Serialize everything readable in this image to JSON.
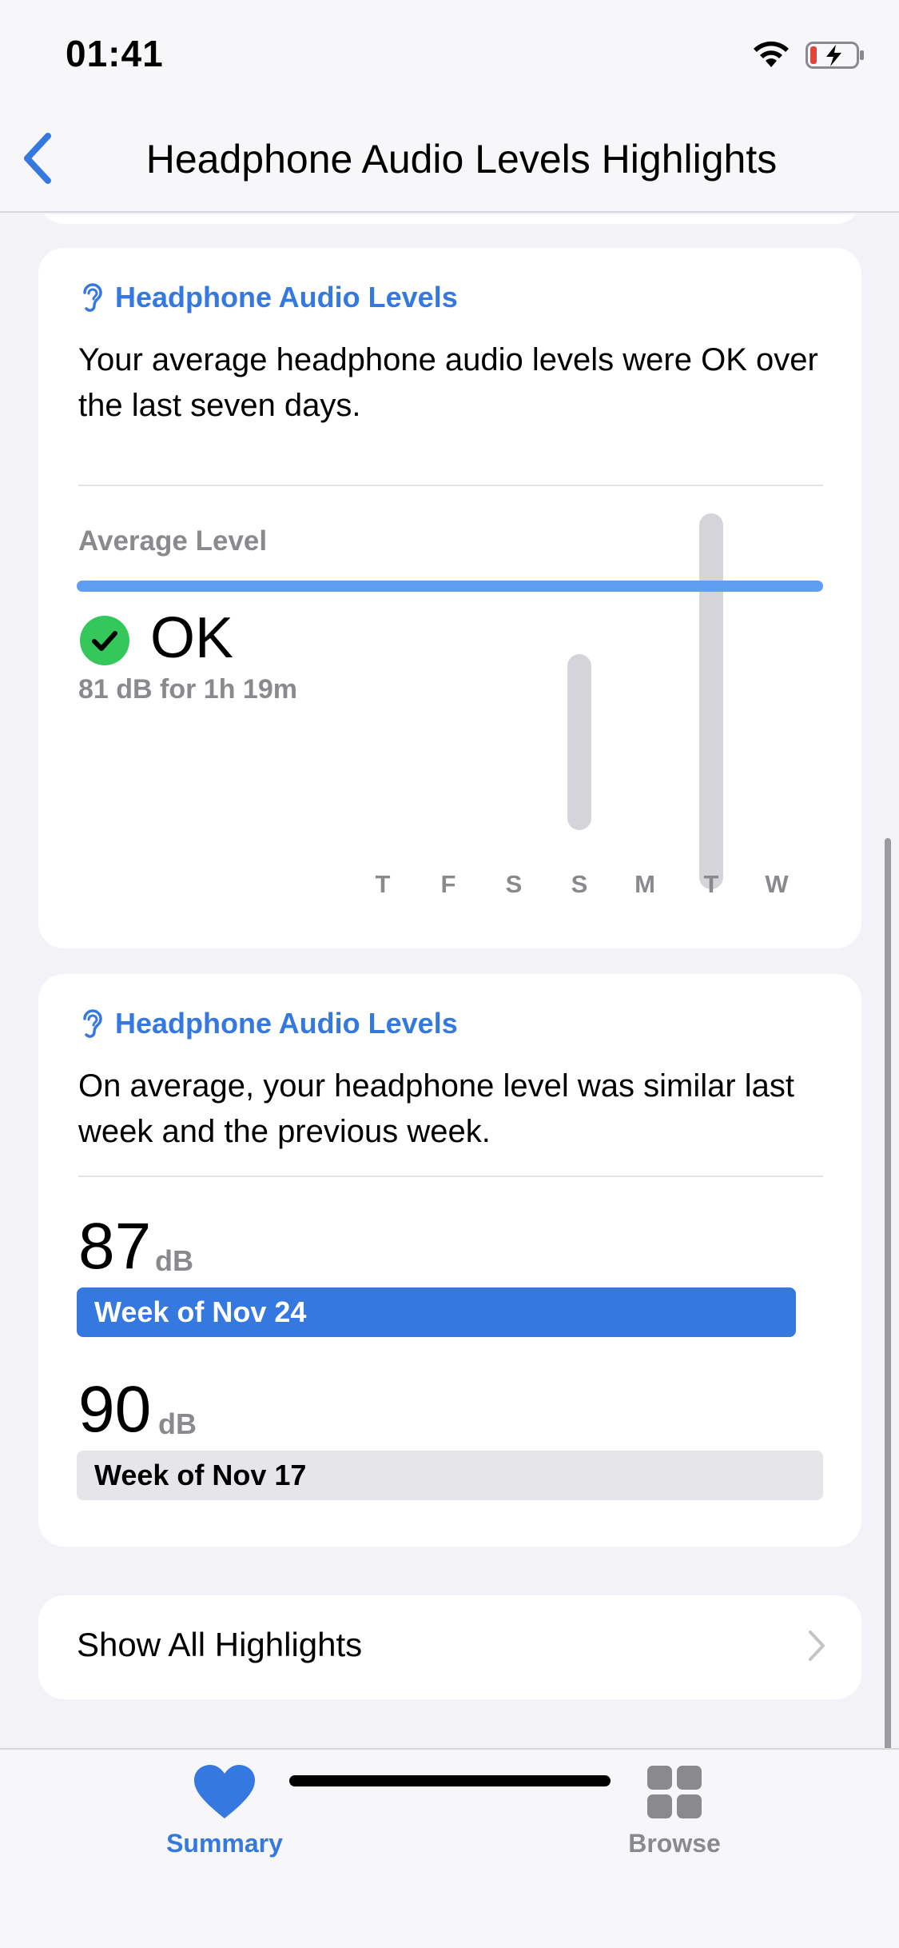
{
  "status_bar": {
    "time": "01:41"
  },
  "nav": {
    "title": "Headphone Audio Levels Highlights"
  },
  "card1": {
    "header": "Headphone Audio Levels",
    "text": "Your average headphone audio levels were OK over the last seven days.",
    "avg_label": "Average Level",
    "status": "OK",
    "detail": "81 dB for 1h 19m",
    "days": [
      "T",
      "F",
      "S",
      "S",
      "M",
      "T",
      "W"
    ]
  },
  "card2": {
    "header": "Headphone Audio Levels",
    "text": "On average, your headphone level was similar last week and the previous week.",
    "weeks": [
      {
        "value": "87",
        "unit": "dB",
        "label": "Week of Nov 24"
      },
      {
        "value": "90",
        "unit": "dB",
        "label": "Week of Nov 17"
      }
    ]
  },
  "show_all": {
    "label": "Show All Highlights"
  },
  "tabs": [
    {
      "label": "Summary",
      "active": true
    },
    {
      "label": "Browse",
      "active": false
    }
  ],
  "colors": {
    "accent": "#3478e0",
    "ok_green": "#34c759",
    "bar_gray": "#d4d4d9",
    "avg_line": "#5f9ff2"
  }
}
